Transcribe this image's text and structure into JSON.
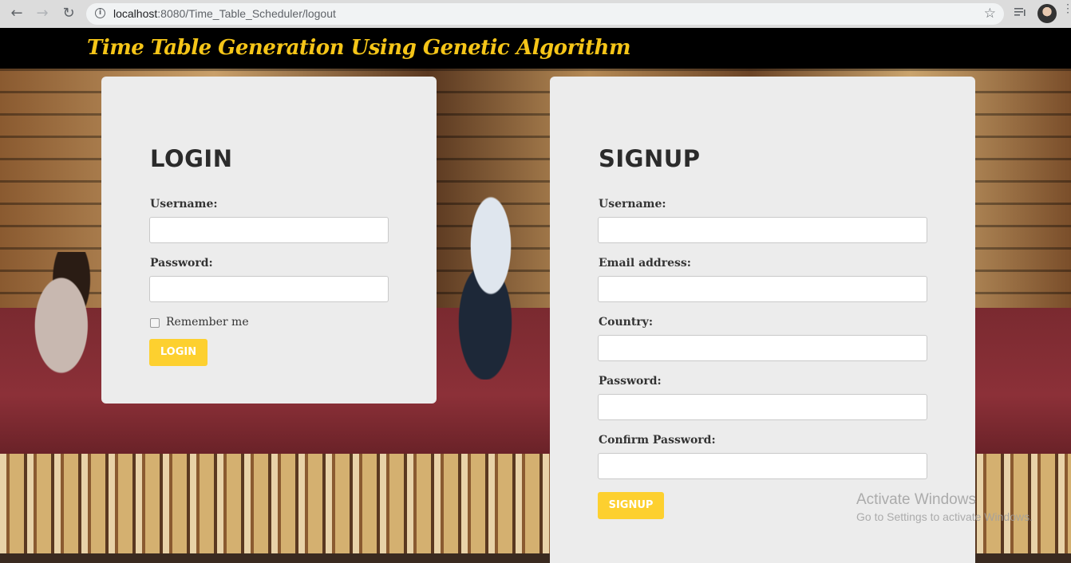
{
  "browser": {
    "back_icon": "back-arrow-icon",
    "forward_icon": "forward-arrow-icon",
    "reload_icon": "reload-icon",
    "url_host": "localhost",
    "url_path": ":8080/Time_Table_Scheduler/logout",
    "bookmark_icon": "star-icon"
  },
  "header": {
    "title": "Time Table Generation Using Genetic Algorithm"
  },
  "login": {
    "title": "LOGIN",
    "username_label": "Username:",
    "username_value": "",
    "password_label": "Password:",
    "password_value": "",
    "remember_label": "Remember me",
    "remember_checked": false,
    "button_label": "LOGIN"
  },
  "signup": {
    "title": "SIGNUP",
    "username_label": "Username:",
    "email_label": "Email address:",
    "country_label": "Country:",
    "password_label": "Password:",
    "confirm_label": "Confirm Password:",
    "button_label": "SIGNUP"
  },
  "watermark": {
    "title": "Activate Windows",
    "subtitle": "Go to Settings to activate Windows."
  },
  "colors": {
    "accent": "#fdd02f",
    "title_yellow": "#f5c518",
    "card_bg": "#ececec",
    "header_bg": "#000000"
  }
}
